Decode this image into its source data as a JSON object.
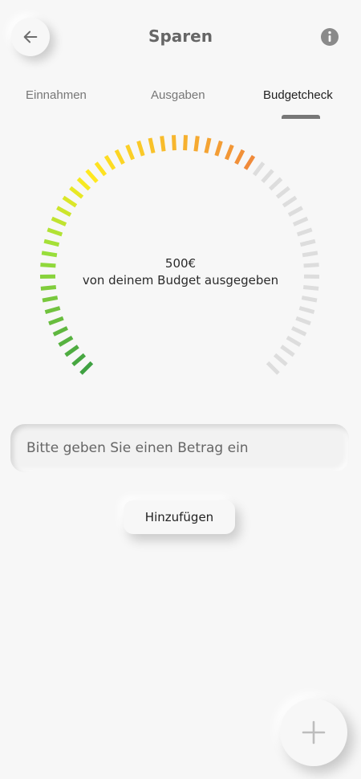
{
  "header": {
    "title": "Sparen",
    "back_icon": "arrow-left-icon",
    "info_icon": "info-circle-icon"
  },
  "tabs": [
    {
      "label": "Einnahmen",
      "active": false
    },
    {
      "label": "Ausgaben",
      "active": false
    },
    {
      "label": "Budgetcheck",
      "active": true
    }
  ],
  "budget": {
    "amount": "500€",
    "caption": "von deinem Budget ausgegeben",
    "spent_fraction": 0.63
  },
  "form": {
    "amount_placeholder": "Bitte geben Sie einen Betrag ein",
    "amount_value": "",
    "add_label": "Hinzufügen"
  },
  "fab": {
    "icon": "plus-icon"
  },
  "colors": {
    "gauge_start": "#3fa142",
    "gauge_yellow": "#ffea1f",
    "gauge_end": "#f08a3a",
    "gauge_inactive": "#dddddd"
  }
}
